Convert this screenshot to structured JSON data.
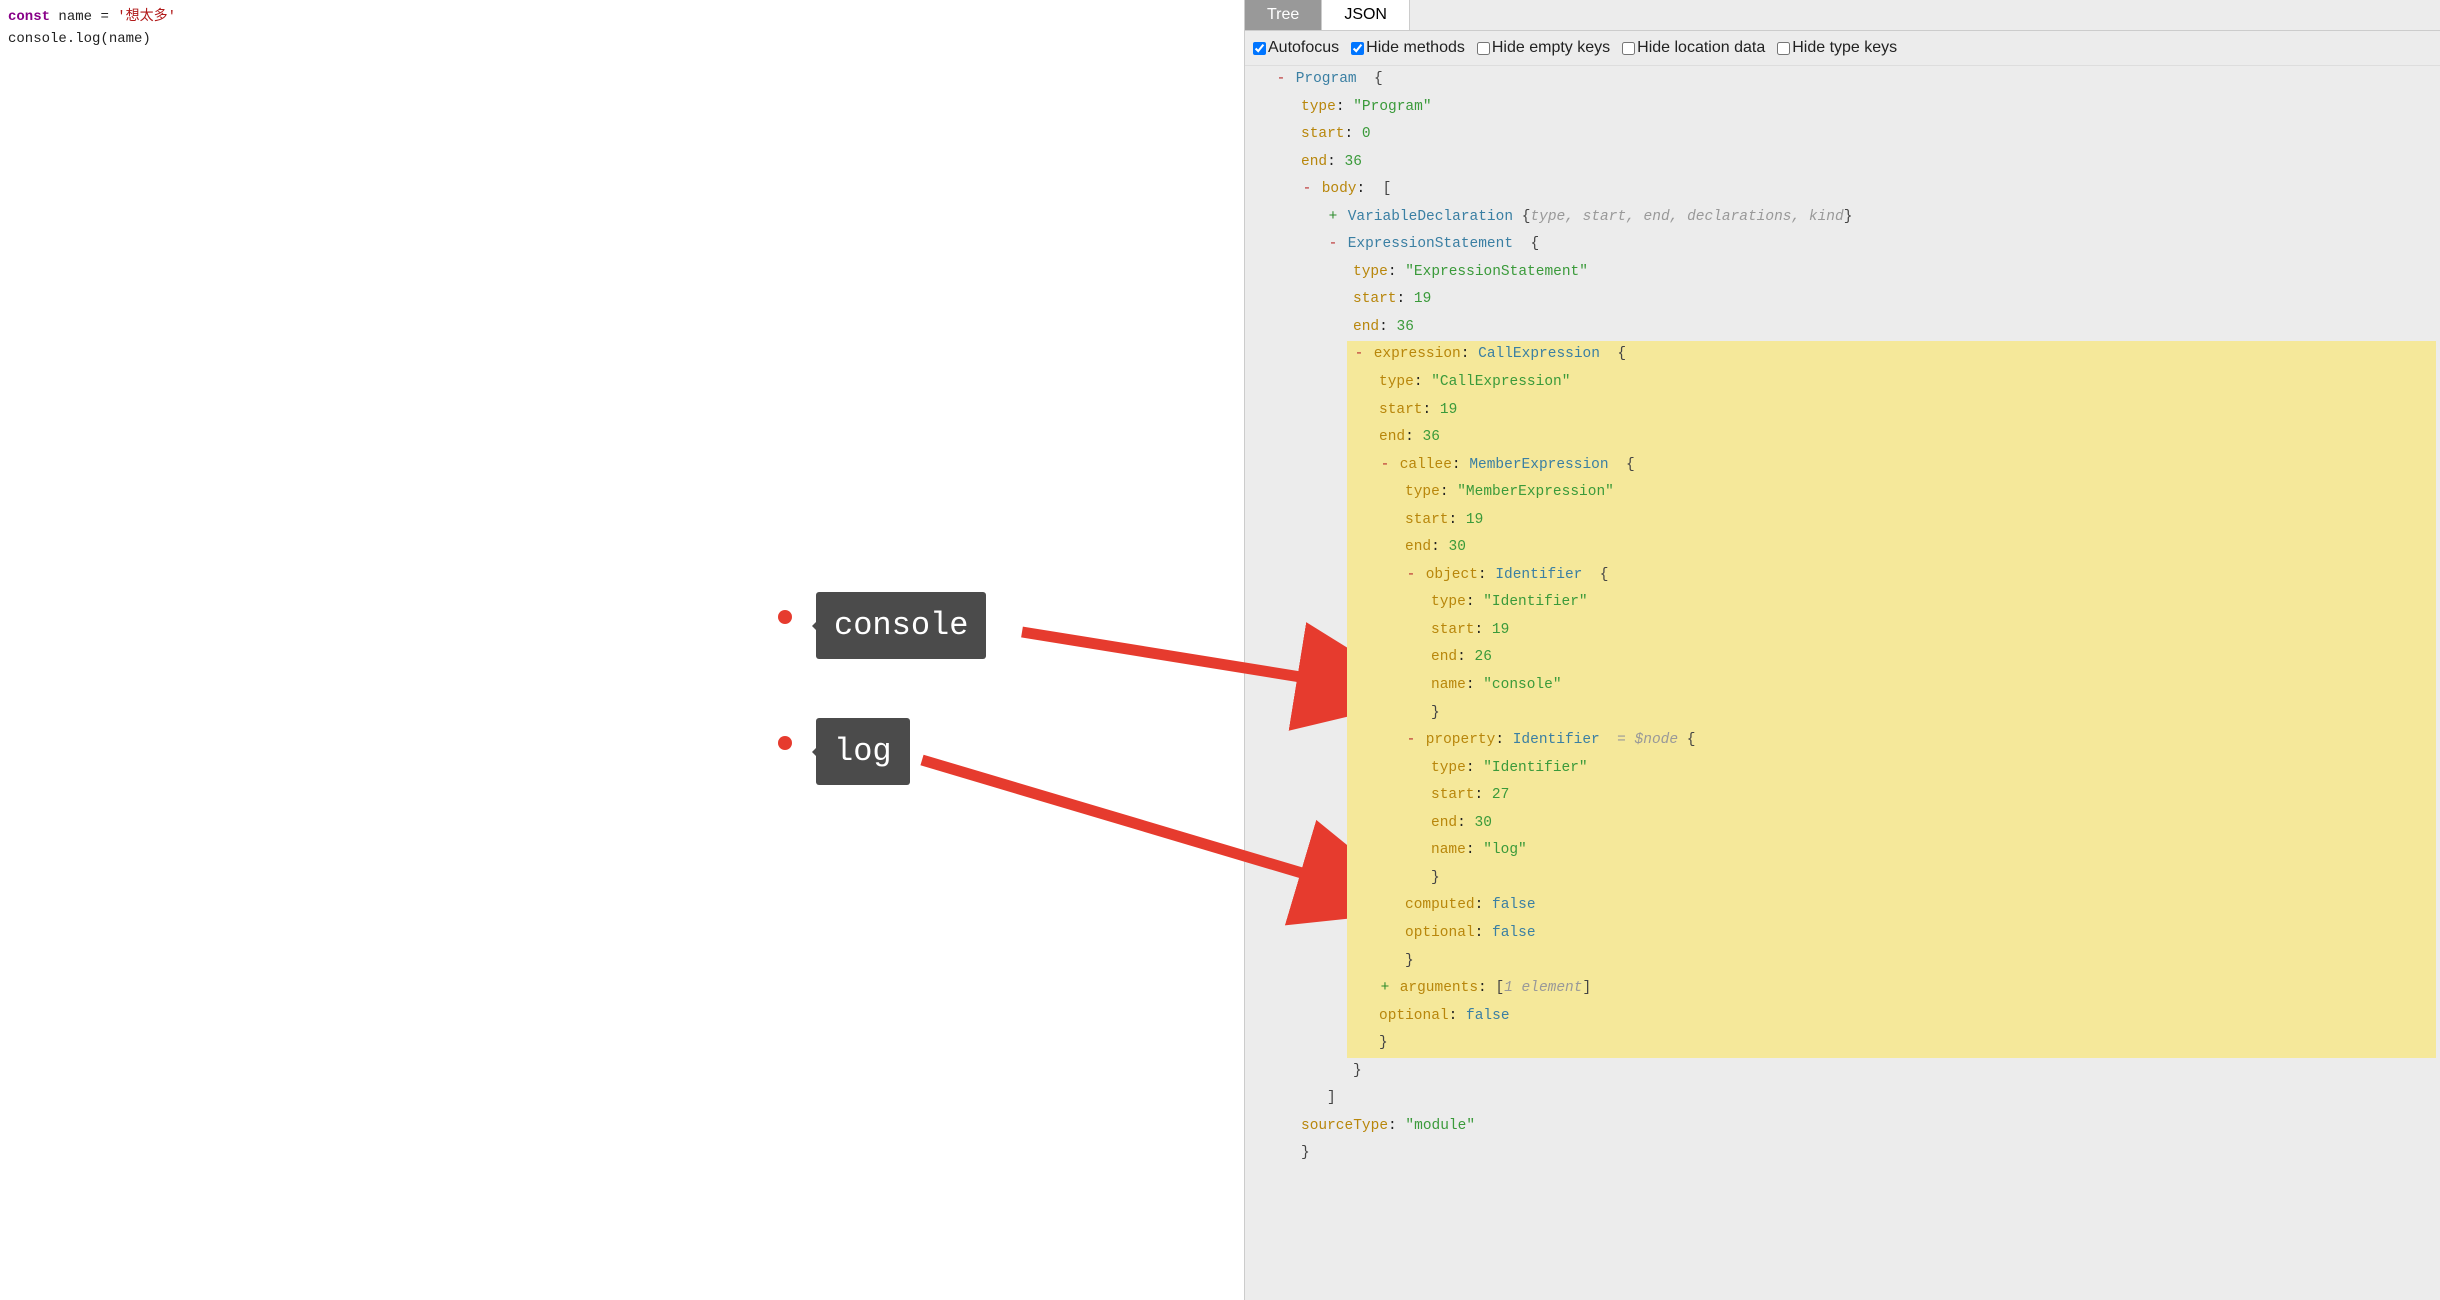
{
  "code": {
    "line1_keyword": "const",
    "line1_varname": "name",
    "line1_op": "=",
    "line1_str": "'想太多'",
    "line2": "console.log(name)"
  },
  "tabs": {
    "tree": "Tree",
    "json": "JSON"
  },
  "options": {
    "autofocus": "Autofocus",
    "hideMethods": "Hide methods",
    "hideEmptyKeys": "Hide empty keys",
    "hideLocationData": "Hide location data",
    "hideTypeKeys": "Hide type keys"
  },
  "ast": {
    "program": "Program",
    "brace_open": "{",
    "brace_close": "}",
    "bracket_meta": "[",
    "type_k": "type",
    "type_program": "\"Program\"",
    "start_k": "start",
    "end_k": "end",
    "prog_start": "0",
    "prog_end": "36",
    "body_k": "body",
    "vardecl": "VariableDeclaration",
    "vardecl_meta": "type, start, end, declarations, kind",
    "exprstmt": "ExpressionStatement",
    "exprstmt_type": "\"ExpressionStatement\"",
    "exprstmt_start": "19",
    "exprstmt_end": "36",
    "expression_k": "expression",
    "callexpr": "CallExpression",
    "callexpr_type": "\"CallExpression\"",
    "callexpr_start": "19",
    "callexpr_end": "36",
    "callee_k": "callee",
    "memberexpr": "MemberExpression",
    "memberexpr_type": "\"MemberExpression\"",
    "memberexpr_start": "19",
    "memberexpr_end": "30",
    "object_k": "object",
    "identifier": "Identifier",
    "ident_type": "\"Identifier\"",
    "obj_start": "19",
    "obj_end": "26",
    "name_k": "name",
    "obj_name": "\"console\"",
    "property_k": "property",
    "prop_node_meta": "= $node",
    "prop_start": "27",
    "prop_end": "30",
    "prop_name": "\"log\"",
    "computed_k": "computed",
    "false_v": "false",
    "optional_k": "optional",
    "arguments_k": "arguments",
    "arguments_meta": "1 element",
    "sourceType_k": "sourceType",
    "sourceType_v": "\"module\""
  },
  "annotations": {
    "console": "console",
    "log": "log"
  }
}
